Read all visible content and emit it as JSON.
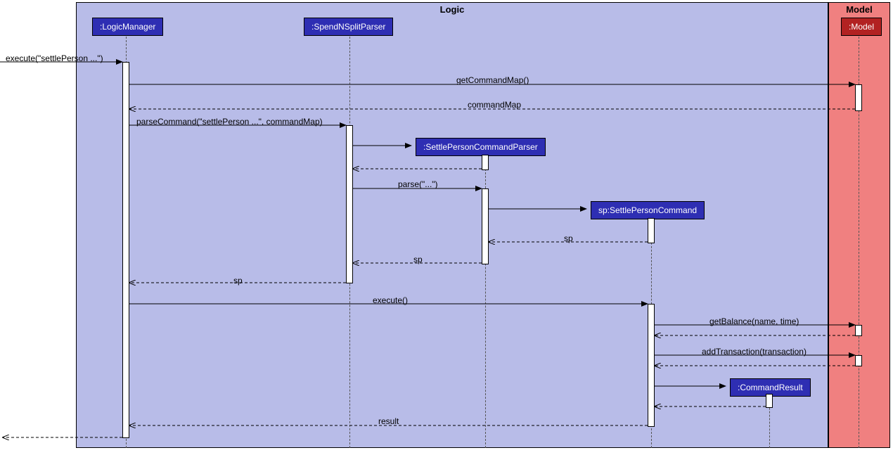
{
  "frames": {
    "logic": "Logic",
    "model": "Model"
  },
  "participants": {
    "logicManager": ":LogicManager",
    "spendNSplitParser": ":SpendNSplitParser",
    "settlePersonCommandParser": ":SettlePersonCommandParser",
    "spSettlePersonCommand": "sp:SettlePersonCommand",
    "model": ":Model",
    "commandResult": ":CommandResult"
  },
  "messages": {
    "execute1": "execute(\"settlePerson ...\")",
    "getCommandMap": "getCommandMap()",
    "commandMap": "commandMap",
    "parseCommand": "parseCommand(\"settlePerson ...\", commandMap)",
    "parse": "parse(\"...\")",
    "sp1": "sp",
    "sp2": "sp",
    "sp3": "sp",
    "execute2": "execute()",
    "getBalance": "getBalance(name, time)",
    "addTransaction": "addTransaction(transaction)",
    "result": "result"
  }
}
